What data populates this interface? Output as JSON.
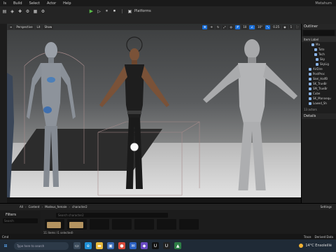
{
  "menubar": {
    "items": [
      "ls",
      "Build",
      "Select",
      "Actor",
      "Help"
    ],
    "title_right": "Metahum"
  },
  "toolbar": {
    "platforms_label": "Platforms"
  },
  "viewport": {
    "perspective_label": "Perspective",
    "lit_label": "Lit",
    "show_label": "Show",
    "grid_value": "10",
    "angle_value": "10°",
    "scale_value": "0.25",
    "camera_speed": "1",
    "background_gradient": [
      "#3d3f40",
      "#8a8b8b",
      "#c9c9c9"
    ]
  },
  "outliner": {
    "title": "Outliner",
    "label_header": "Item Label",
    "items": [
      "Ma",
      "Tuto",
      "Tech",
      "Sky",
      "SkyLig",
      "AirDire",
      "PostProc",
      "Skel_HalfB",
      "SK_TrueBr",
      "SM_TrueBr",
      "Cube",
      "SK_Mannequ",
      "Lowed_Sh"
    ],
    "actors_count": "13 actors",
    "details_title": "Details"
  },
  "content_browser": {
    "all_label": "All",
    "crumbs": [
      "Content",
      "Modeus_female",
      "character2"
    ],
    "settings_label": "Settings",
    "filters_label": "Filters",
    "filter_placeholder": "Search",
    "search_placeholder": "Search character2",
    "items_count": "11 items (1 selected)"
  },
  "statusbar": {
    "left": "Cmd",
    "trace": "Trace",
    "derived_data": "Derived Data"
  },
  "taskbar": {
    "search_placeholder": "Type here to search",
    "weather": "14°C  Ensoleillé"
  }
}
